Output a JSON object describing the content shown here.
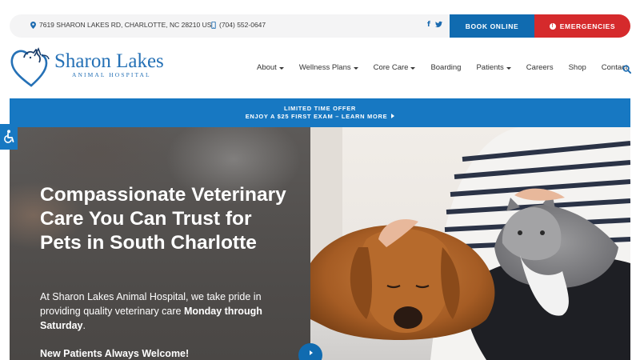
{
  "topbar": {
    "address": "7619 SHARON LAKES RD, CHARLOTTE, NC 28210 US",
    "phone": "(704) 552-0647",
    "social": [
      {
        "icon": "facebook-icon",
        "glyph": "f"
      },
      {
        "icon": "twitter-icon",
        "glyph": "t"
      }
    ],
    "book_label": "BOOK ONLINE",
    "emergency_label": "EMERGENCIES"
  },
  "logo": {
    "name": "Sharon Lakes",
    "subtitle": "ANIMAL HOSPITAL"
  },
  "nav": {
    "items": [
      {
        "label": "About",
        "dropdown": true
      },
      {
        "label": "Wellness Plans",
        "dropdown": true
      },
      {
        "label": "Core Care",
        "dropdown": true
      },
      {
        "label": "Boarding",
        "dropdown": false
      },
      {
        "label": "Patients",
        "dropdown": true
      },
      {
        "label": "Careers",
        "dropdown": false
      },
      {
        "label": "Shop",
        "dropdown": false
      },
      {
        "label": "Contact",
        "dropdown": false
      }
    ]
  },
  "promo": {
    "line1": "LIMITED TIME OFFER",
    "line2": "ENJOY A $25 FIRST EXAM – LEARN MORE"
  },
  "hero": {
    "title": "Compassionate Veterinary Care You Can Trust for Pets in South Charlotte",
    "text_before": "At Sharon Lakes Animal Hospital, we take pride in providing quality veterinary care ",
    "text_bold": "Monday through Saturday",
    "text_after": ".",
    "cta": "New Patients Always Welcome!"
  },
  "colors": {
    "brand_blue": "#106bb0",
    "promo_blue": "#1778c2",
    "emergency_red": "#d52a2c"
  }
}
